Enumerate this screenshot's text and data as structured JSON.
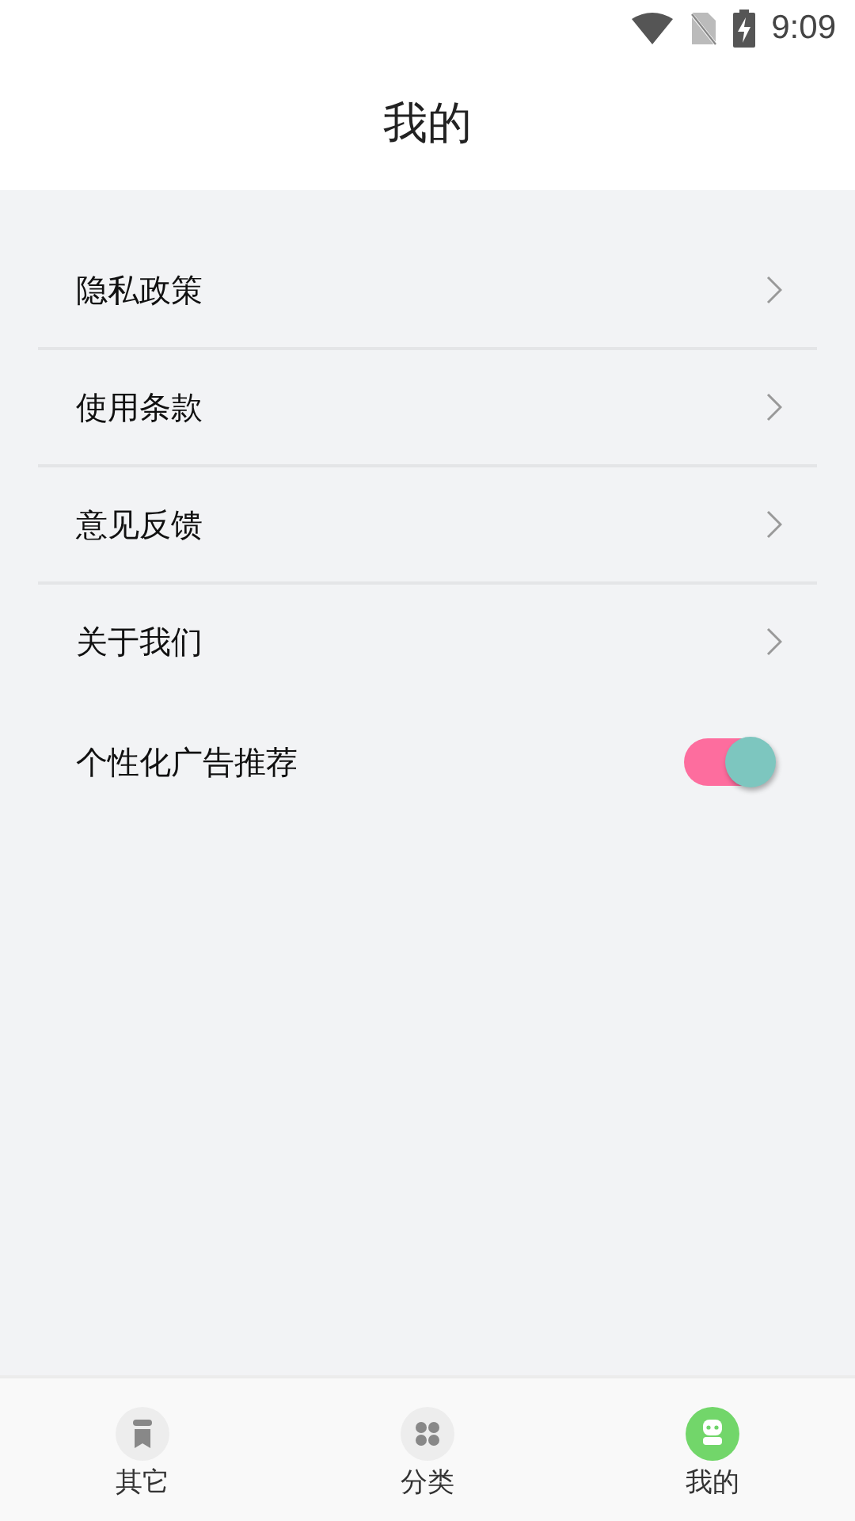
{
  "status_bar": {
    "time": "9:09"
  },
  "header": {
    "title": "我的"
  },
  "menu": [
    {
      "kind": "link",
      "label": "隐私政策"
    },
    {
      "kind": "link",
      "label": "使用条款"
    },
    {
      "kind": "link",
      "label": "意见反馈"
    },
    {
      "kind": "link",
      "label": "关于我们"
    },
    {
      "kind": "toggle",
      "label": "个性化广告推荐",
      "on": true
    }
  ],
  "tabs": [
    {
      "kind": "bookmark",
      "label": "其它",
      "selected": false
    },
    {
      "kind": "grid",
      "label": "分类",
      "selected": false
    },
    {
      "kind": "robot",
      "label": "我的",
      "selected": true
    }
  ]
}
